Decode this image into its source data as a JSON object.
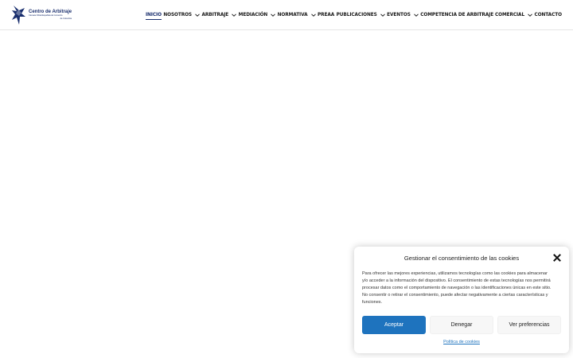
{
  "header": {
    "logo": {
      "title": "Centro de Arbitraje",
      "subtitle_line1": "Cámara Oficial Española de Comercio",
      "subtitle_line2": "de Colombia"
    },
    "nav": [
      {
        "label": "INICIO",
        "active": true,
        "dropdown": false
      },
      {
        "label": "NOSOTROS",
        "active": false,
        "dropdown": true
      },
      {
        "label": "ARBITRAJE",
        "active": false,
        "dropdown": true
      },
      {
        "label": "MEDIACIÓN",
        "active": false,
        "dropdown": true
      },
      {
        "label": "NORMATIVA",
        "active": false,
        "dropdown": true
      },
      {
        "label": "PREAA",
        "active": false,
        "dropdown": false
      },
      {
        "label": "PUBLICACIONES",
        "active": false,
        "dropdown": true
      },
      {
        "label": "EVENTOS",
        "active": false,
        "dropdown": true
      },
      {
        "label": "COMPETENCIA DE ARBITRAJE COMERCIAL",
        "active": false,
        "dropdown": true
      },
      {
        "label": "CONTACTO",
        "active": false,
        "dropdown": false
      }
    ]
  },
  "cookie_banner": {
    "title": "Gestionar el consentimiento de las cookies",
    "body": "Para ofrecer las mejores experiencias, utilizamos tecnologías como las cookies para almacenar y/o acceder a la información del dispositivo. El consentimiento de estas tecnologías nos permitirá procesar datos como el comportamiento de navegación o las identificaciones únicas en este sitio. No consentir o retirar el consentimiento, puede afectar negativamente a ciertas características y funciones.",
    "accept_label": "Aceptar",
    "deny_label": "Denegar",
    "prefs_label": "Ver preferencias",
    "policy_link": "Política de cookies"
  },
  "colors": {
    "brand": "#1a2f6e",
    "accept_button": "#1e73be"
  },
  "icons": {
    "close": "close-icon",
    "chevron": "chevron-down-icon",
    "logo": "logo-mark-icon"
  }
}
